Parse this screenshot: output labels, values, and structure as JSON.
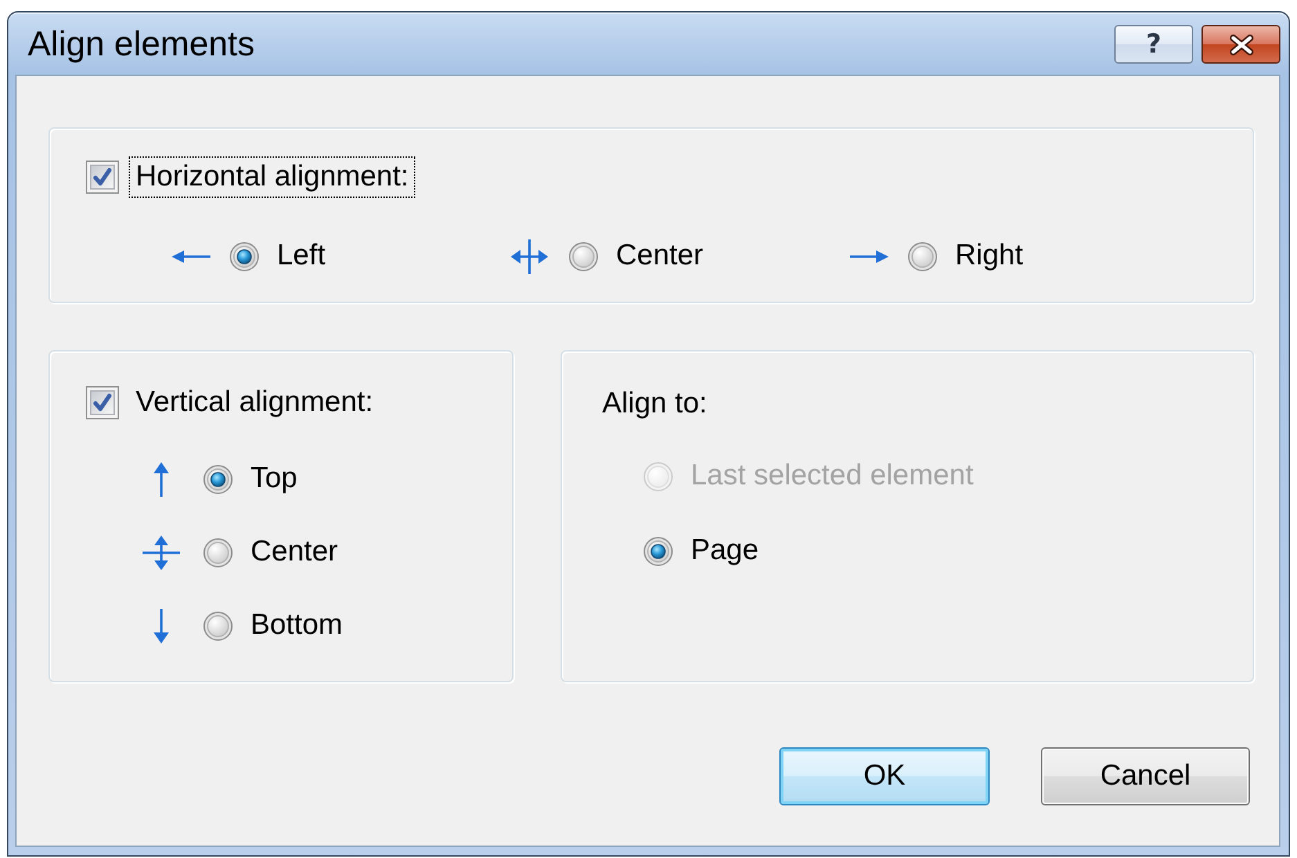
{
  "window": {
    "title": "Align elements",
    "help_button": {
      "label": "?"
    }
  },
  "horizontal_group": {
    "checkbox": {
      "label": "Horizontal alignment:",
      "checked": true,
      "focused": true
    },
    "options": [
      {
        "label": "Left",
        "selected": true
      },
      {
        "label": "Center",
        "selected": false
      },
      {
        "label": "Right",
        "selected": false
      }
    ]
  },
  "vertical_group": {
    "checkbox": {
      "label": "Vertical alignment:",
      "checked": true,
      "focused": false
    },
    "options": [
      {
        "label": "Top",
        "selected": true
      },
      {
        "label": "Center",
        "selected": false
      },
      {
        "label": "Bottom",
        "selected": false
      }
    ]
  },
  "align_to_group": {
    "label": "Align to:",
    "options": [
      {
        "label": "Last selected element",
        "selected": false,
        "disabled": true
      },
      {
        "label": "Page",
        "selected": true,
        "disabled": false
      }
    ]
  },
  "buttons": [
    {
      "label": "OK",
      "default": true
    },
    {
      "label": "Cancel",
      "default": false
    }
  ]
}
